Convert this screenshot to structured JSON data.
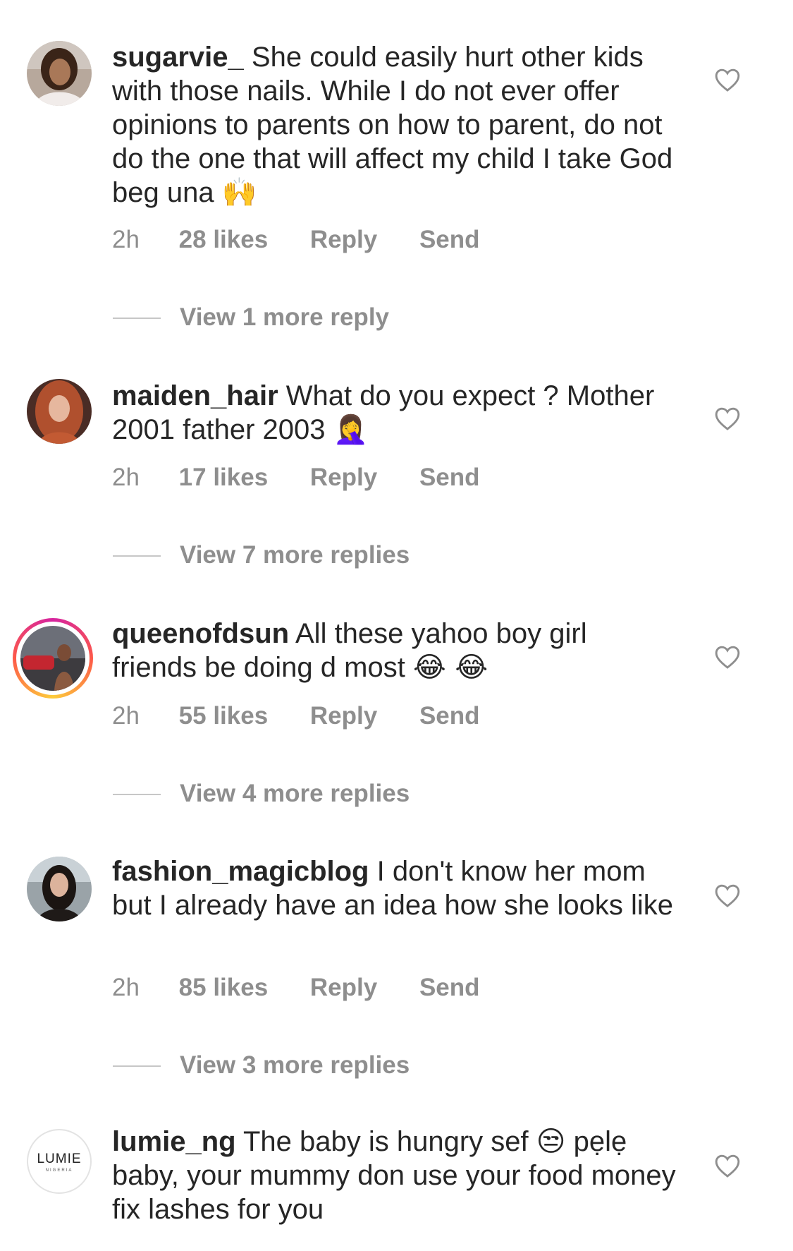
{
  "comments": [
    {
      "username": "sugarvie_",
      "text": "She could easily hurt other kids with those nails. While I do not ever offer opinions to parents on how to parent, do not do the one that will affect my child I take God beg una",
      "emoji": "🙌",
      "time": "2h",
      "likes": "28 likes",
      "reply": "Reply",
      "send": "Send",
      "view_more": "View 1 more reply"
    },
    {
      "username": "maiden_hair",
      "text": "What do you expect ? Mother 2001 father 2003",
      "emoji": "🤦‍♀️",
      "time": "2h",
      "likes": "17 likes",
      "reply": "Reply",
      "send": "Send",
      "view_more": "View 7 more replies"
    },
    {
      "username": "queenofdsun",
      "text": "All these yahoo boy girl friends be doing d most",
      "emoji": "😂 😂",
      "time": "2h",
      "likes": "55 likes",
      "reply": "Reply",
      "send": "Send",
      "view_more": "View 4 more replies"
    },
    {
      "username": "fashion_magicblog",
      "text": "I don't know her mom but I already have an idea how  she looks like",
      "emoji": "",
      "time": "2h",
      "likes": "85 likes",
      "reply": "Reply",
      "send": "Send",
      "view_more": "View 3 more replies"
    },
    {
      "username": "lumie_ng",
      "text": "The baby is hungry sef",
      "emoji": "😒",
      "text2": "pẹlẹ baby, your mummy don use your food money fix lashes for you",
      "time": "",
      "likes": "",
      "reply": "",
      "send": "",
      "avatar_logo": "LUMIE",
      "avatar_logo_sub": "NIGERIA"
    }
  ],
  "icons": {
    "like": "heart-outline-icon"
  },
  "colors": {
    "text": "#262626",
    "secondary": "#8e8e8e",
    "divider": "#c7c7c7"
  }
}
